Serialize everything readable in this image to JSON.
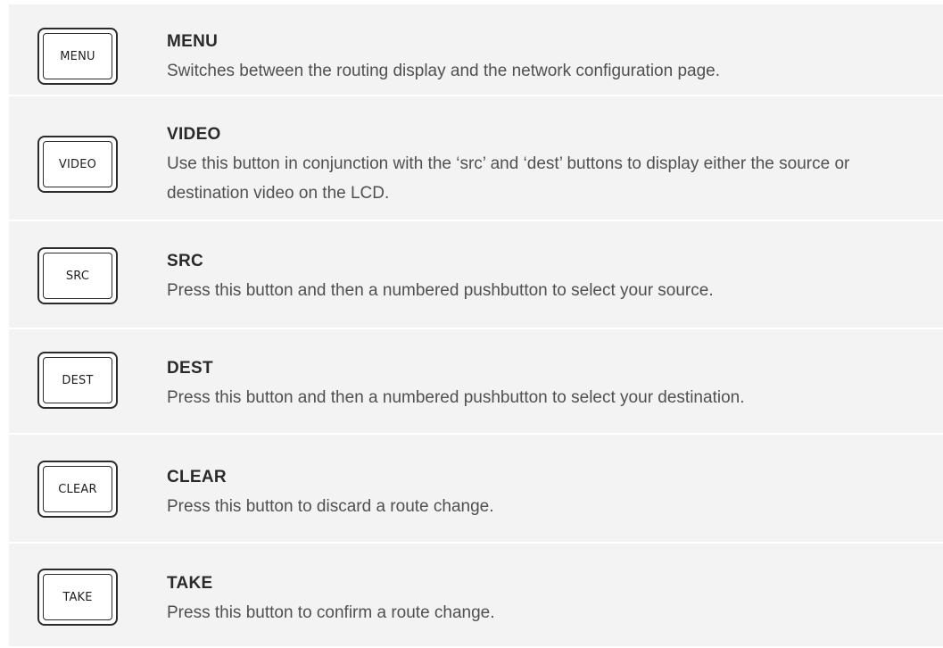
{
  "rows": [
    {
      "button_label": "MENU",
      "title": "MENU",
      "description": "Switches between the routing display and the network configuration page."
    },
    {
      "button_label": "VIDEO",
      "title": "VIDEO",
      "description": "Use this button in conjunction with the ‘src’ and ‘dest’ buttons to display either the source or destination video on the LCD."
    },
    {
      "button_label": "SRC",
      "title": "SRC",
      "description": "Press this button and then a numbered pushbutton to select your source."
    },
    {
      "button_label": "DEST",
      "title": "DEST",
      "description": "Press this button and then a numbered pushbutton to select your destination."
    },
    {
      "button_label": "CLEAR",
      "title": "CLEAR",
      "description": "Press this button to discard a route change."
    },
    {
      "button_label": "TAKE",
      "title": "TAKE",
      "description": "Press this button to confirm a route change."
    }
  ]
}
